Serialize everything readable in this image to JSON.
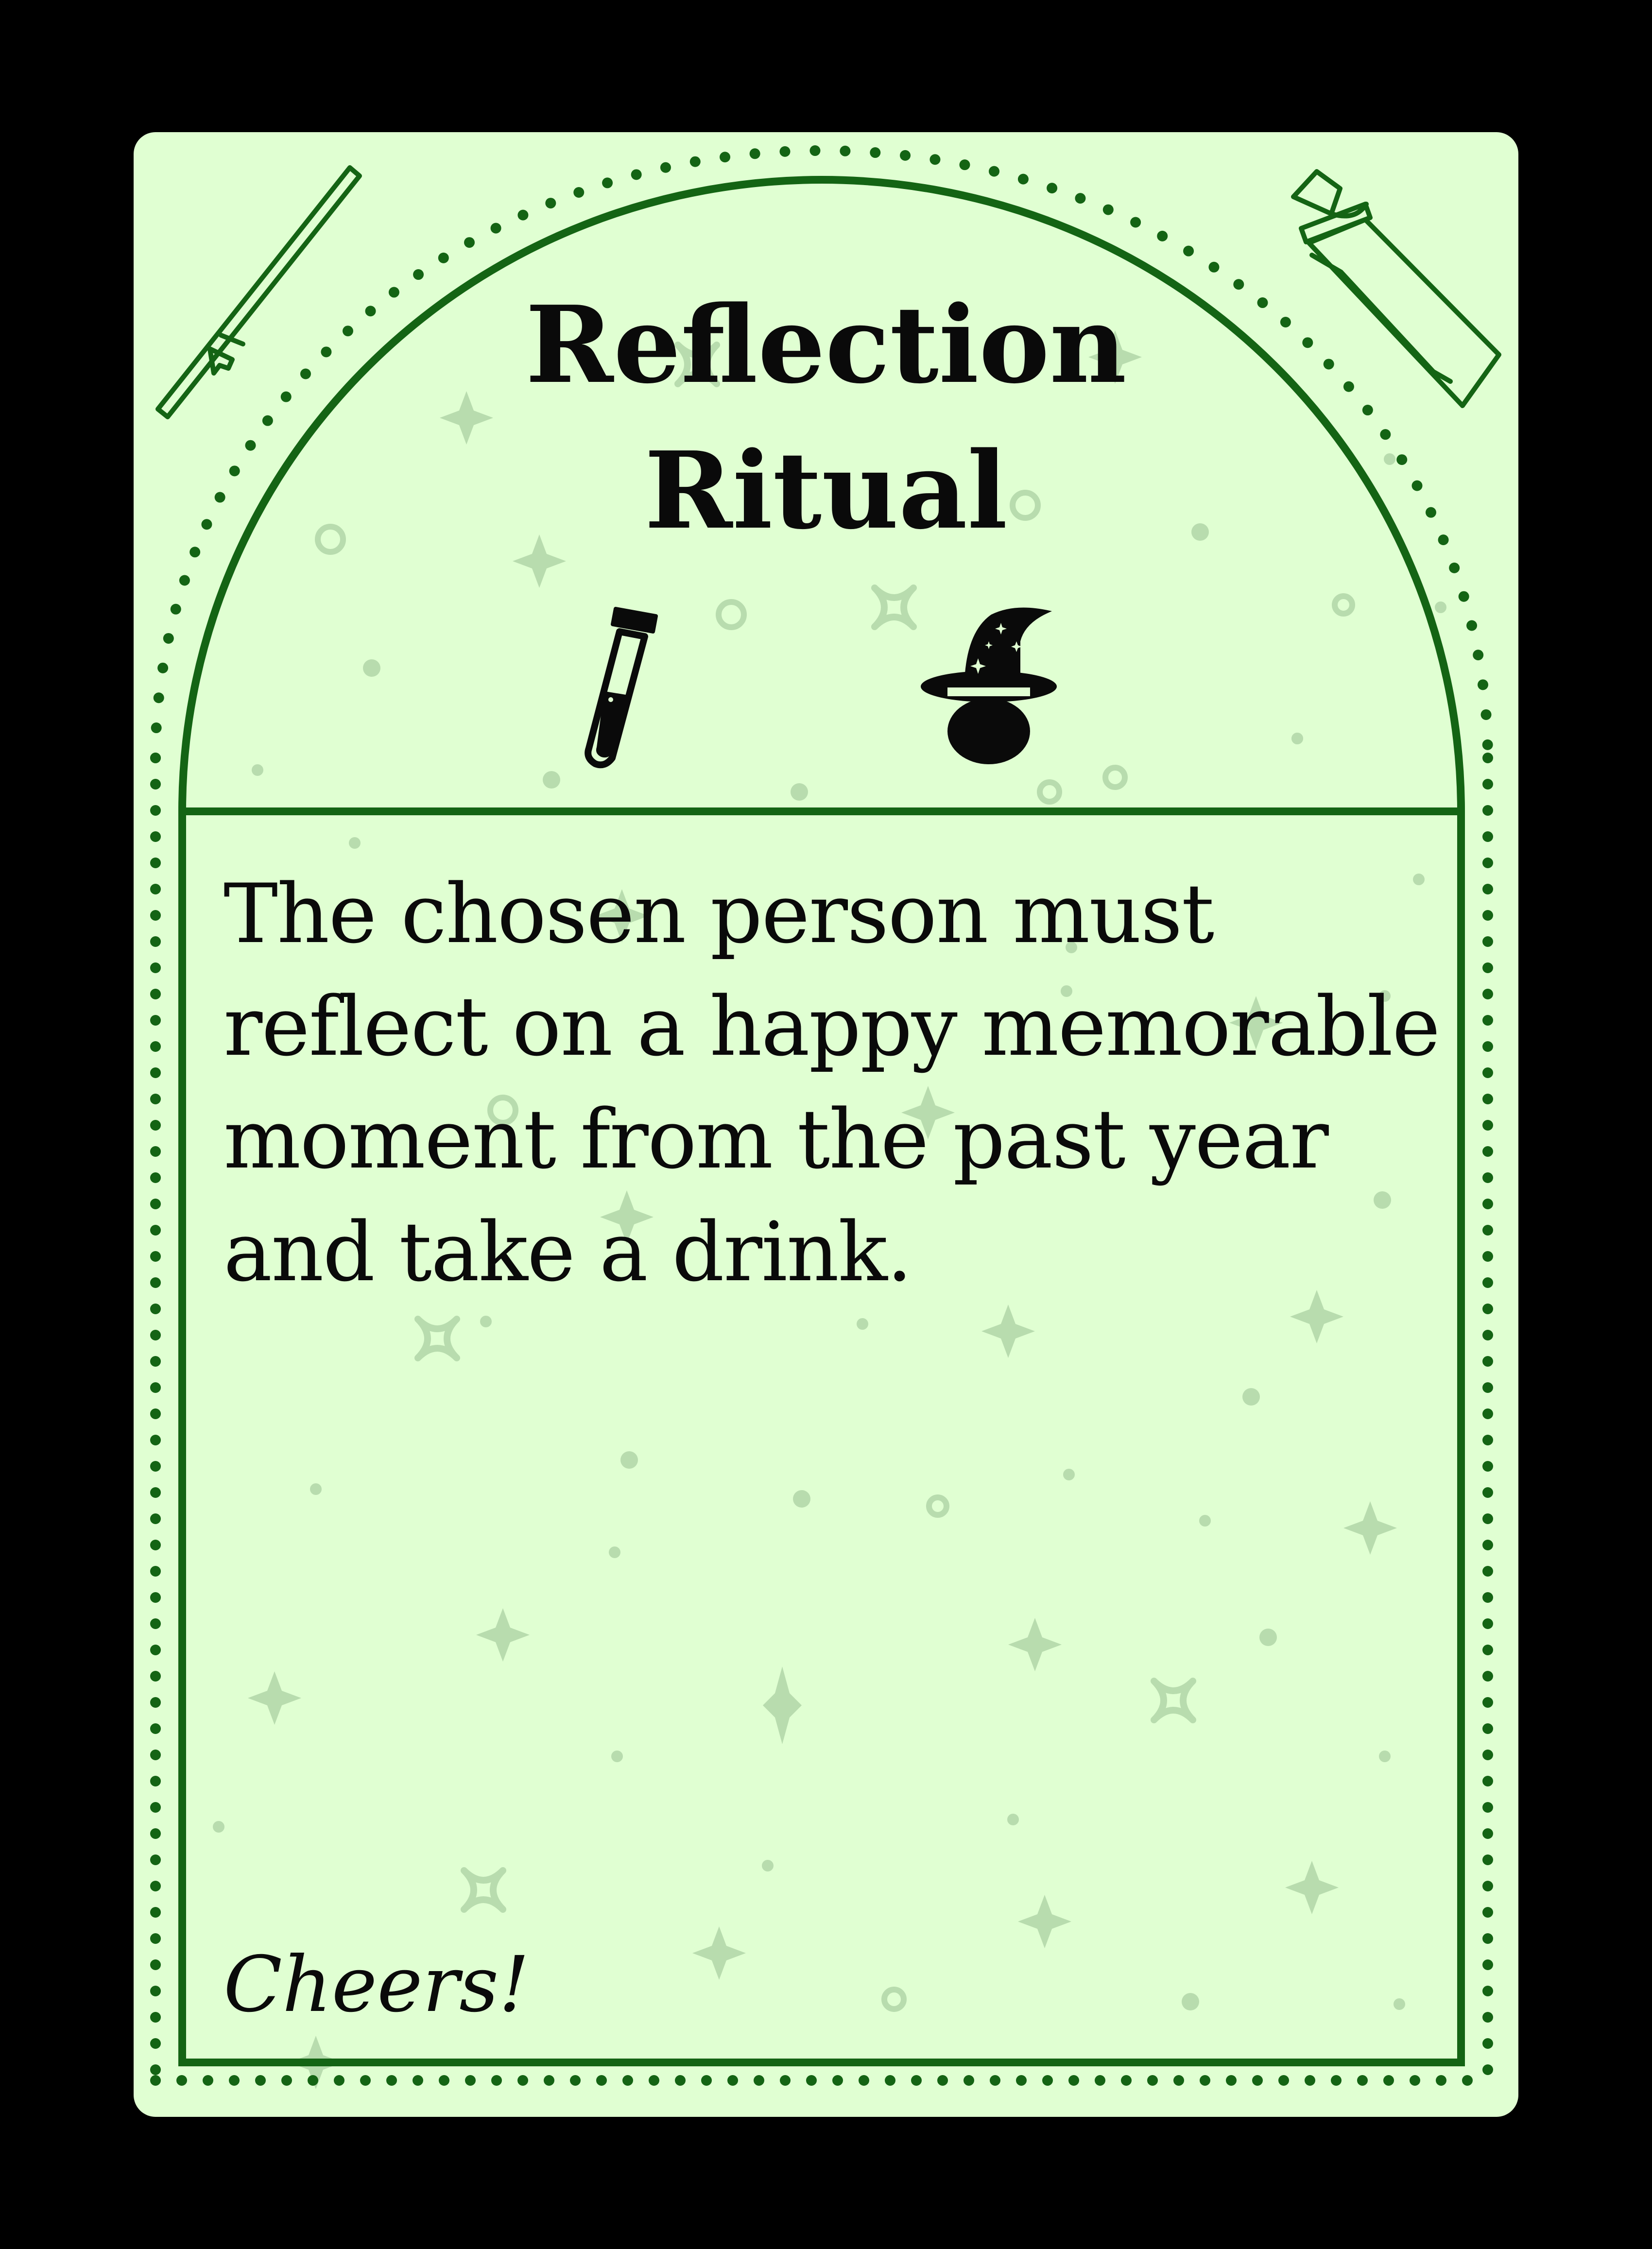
{
  "card": {
    "title": "Reflection Ritual",
    "body": "The chosen person must reflect on a happy memorable moment from the past year and take a drink.",
    "footer": "Cheers!"
  },
  "colors": {
    "background": "#000000",
    "card_fill": "#e0ffd2",
    "border_green": "#146414",
    "decor_green": "#b8dcae",
    "ink": "#0a0a0a"
  },
  "icons": [
    "cocktail-stirrer-icon",
    "cocktail-shaker-icon",
    "test-tube-potion-icon",
    "wizard-hat-icon"
  ]
}
